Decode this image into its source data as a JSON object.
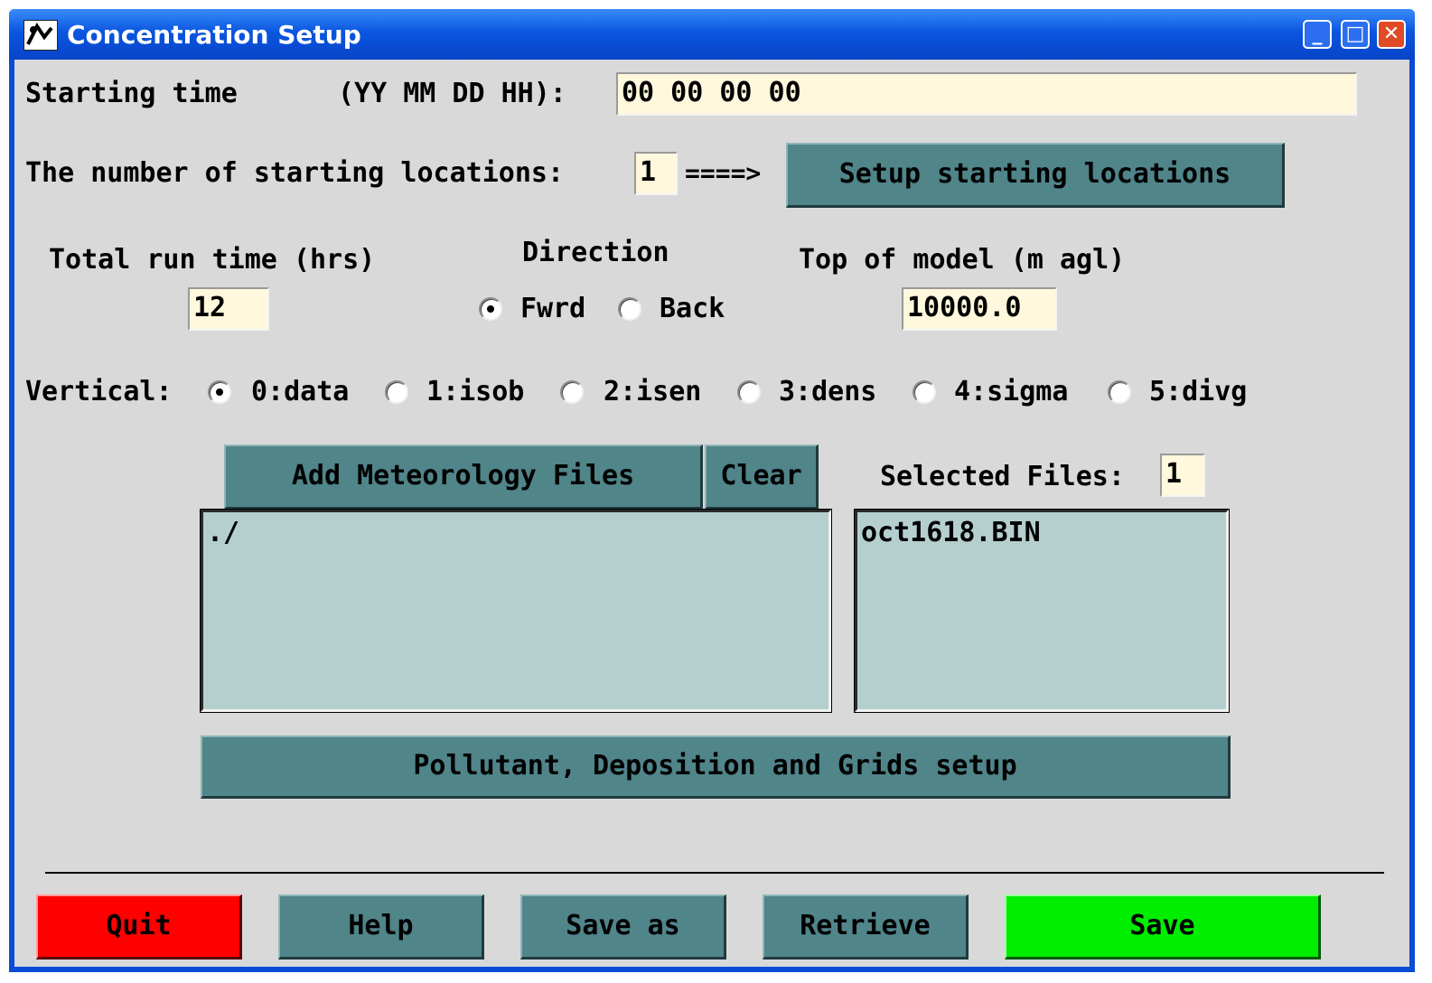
{
  "window": {
    "title": "Concentration Setup",
    "controls": {
      "minimize": "_",
      "maximize": "□",
      "close": "✕"
    }
  },
  "start_time": {
    "label": "Starting time",
    "format_label": "(YY MM DD HH):",
    "value": "00 00 00 00"
  },
  "locations": {
    "label": "The number of starting locations:",
    "count": "1",
    "arrow": "====>",
    "setup_button": "Setup starting locations"
  },
  "run_time": {
    "label": "Total run time (hrs)",
    "value": "12"
  },
  "direction": {
    "label": "Direction",
    "options": [
      {
        "label": "Fwrd",
        "selected": true
      },
      {
        "label": "Back",
        "selected": false
      }
    ]
  },
  "top_of_model": {
    "label": "Top of model (m agl)",
    "value": "10000.0"
  },
  "vertical": {
    "label": "Vertical:",
    "options": [
      {
        "label": "0:data",
        "selected": true
      },
      {
        "label": "1:isob",
        "selected": false
      },
      {
        "label": "2:isen",
        "selected": false
      },
      {
        "label": "3:dens",
        "selected": false
      },
      {
        "label": "4:sigma",
        "selected": false
      },
      {
        "label": "5:divg",
        "selected": false
      }
    ]
  },
  "meteorology": {
    "add_button": "Add Meteorology Files",
    "clear_button": "Clear",
    "selected_label": "Selected Files:",
    "selected_count": "1",
    "directory_list": [
      "./"
    ],
    "file_list": [
      "oct1618.BIN"
    ]
  },
  "pollutant_button": "Pollutant, Deposition and Grids setup",
  "bottom_buttons": {
    "quit": "Quit",
    "help": "Help",
    "save_as": "Save as",
    "retrieve": "Retrieve",
    "save": "Save"
  },
  "colors": {
    "button": "#50858a",
    "quit": "#ff0000",
    "save": "#00ee00",
    "entry": "#fff8dc",
    "listbox": "#b5cfcf",
    "background": "#d9d9d9"
  }
}
